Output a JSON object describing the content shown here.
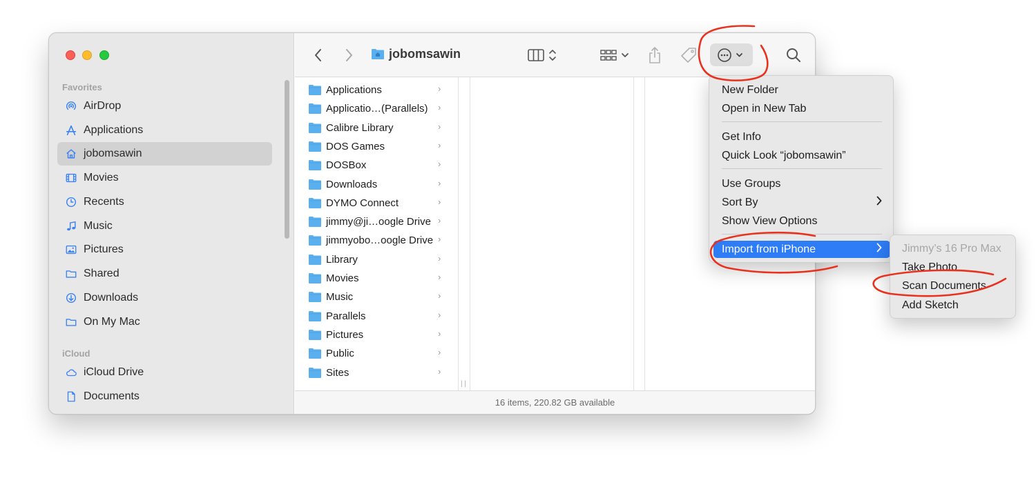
{
  "window": {
    "title": "jobomsawin"
  },
  "sidebar": {
    "favorites_label": "Favorites",
    "favorites": [
      {
        "label": "AirDrop",
        "icon": "airdrop-icon"
      },
      {
        "label": "Applications",
        "icon": "applications-icon"
      },
      {
        "label": "jobomsawin",
        "icon": "home-icon",
        "selected": true
      },
      {
        "label": "Movies",
        "icon": "film-icon"
      },
      {
        "label": "Recents",
        "icon": "clock-icon"
      },
      {
        "label": "Music",
        "icon": "music-note-icon"
      },
      {
        "label": "Pictures",
        "icon": "photo-icon"
      },
      {
        "label": "Shared",
        "icon": "folder-icon"
      },
      {
        "label": "Downloads",
        "icon": "download-icon"
      },
      {
        "label": "On My Mac",
        "icon": "folder-icon"
      }
    ],
    "icloud_label": "iCloud",
    "icloud": [
      {
        "label": "iCloud Drive",
        "icon": "cloud-icon"
      },
      {
        "label": "Documents",
        "icon": "document-icon"
      }
    ]
  },
  "columns": {
    "items": [
      "Applications",
      "Applicatio…(Parallels)",
      "Calibre Library",
      "DOS Games",
      "DOSBox",
      "Downloads",
      "DYMO Connect",
      "jimmy@ji…oogle Drive",
      "jimmyobo…oogle Drive",
      "Library",
      "Movies",
      "Music",
      "Parallels",
      "Pictures",
      "Public",
      "Sites"
    ]
  },
  "status": {
    "text": "16 items, 220.82 GB available"
  },
  "menu": {
    "groups": [
      [
        "New Folder",
        "Open in New Tab"
      ],
      [
        "Get Info",
        "Quick Look “jobomsawin”"
      ],
      [
        "Use Groups",
        "Sort By",
        "Show View Options"
      ],
      [
        "Import from iPhone"
      ]
    ],
    "highlighted": "Import from iPhone"
  },
  "submenu": {
    "device": "Jimmy’s 16 Pro Max",
    "items": [
      "Take Photo",
      "Scan Documents",
      "Add Sketch"
    ]
  },
  "colors": {
    "menu_highlight": "#2e7cf6",
    "annotation": "#e8321e",
    "folder_blue": "#5ab0ee"
  }
}
